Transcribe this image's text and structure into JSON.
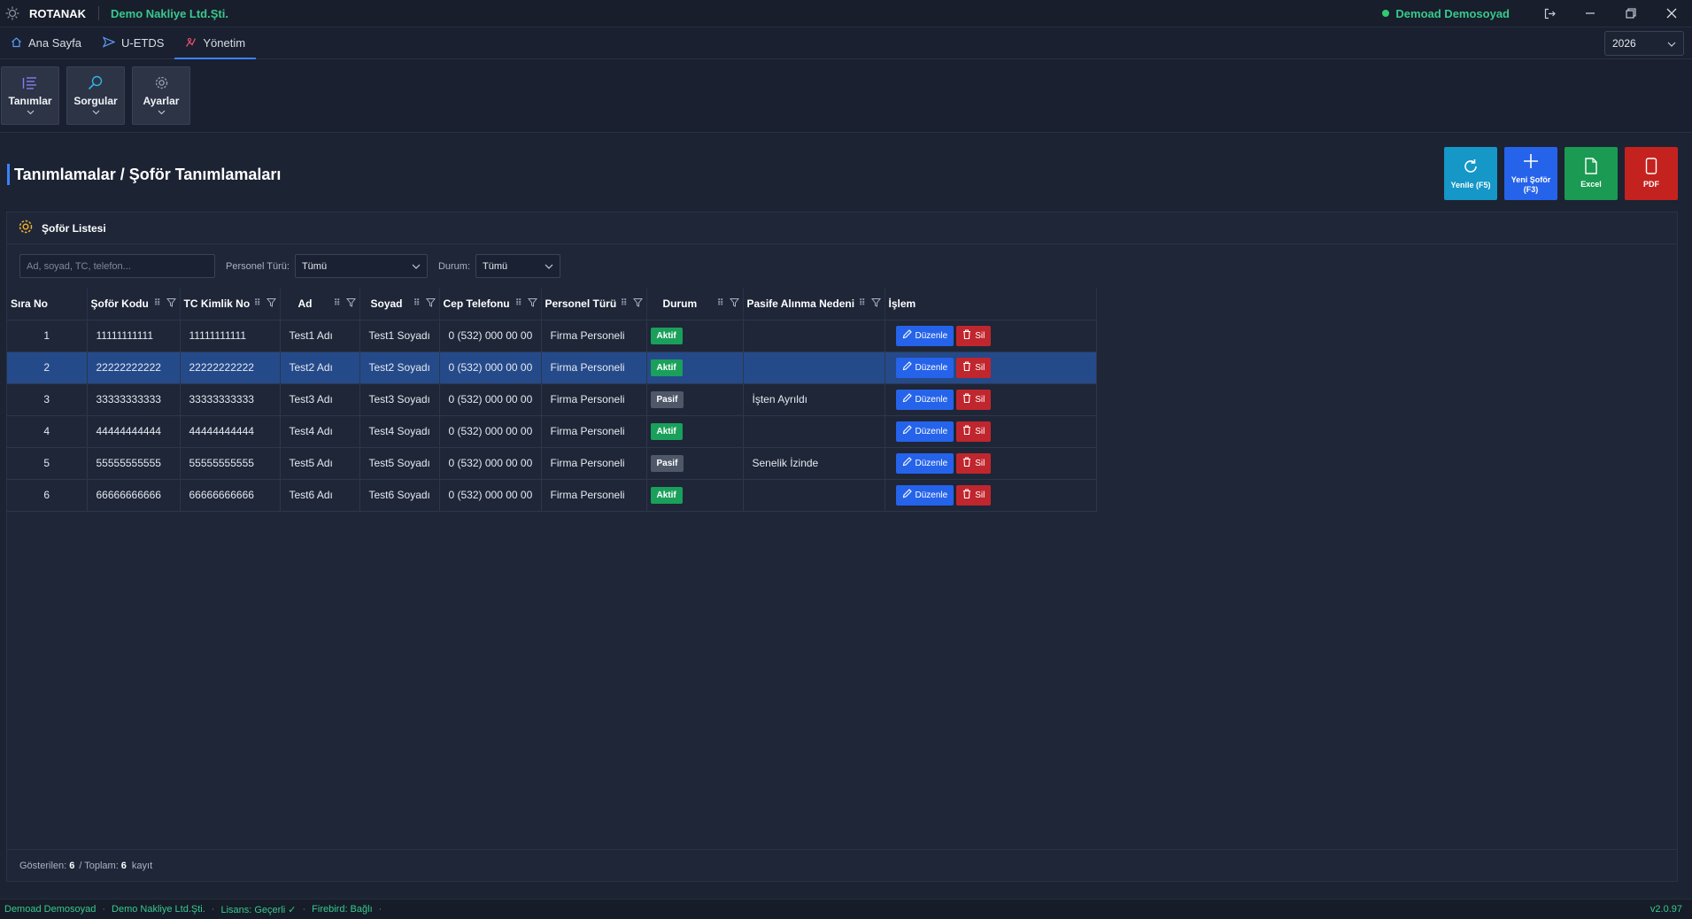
{
  "titlebar": {
    "app_name": "ROTANAK",
    "company": "Demo Nakliye Ltd.Şti.",
    "user": "Demoad Demosoyad"
  },
  "nav": {
    "tabs": [
      {
        "label": "Ana Sayfa",
        "icon": "home-icon"
      },
      {
        "label": "U-ETDS",
        "icon": "send-icon"
      },
      {
        "label": "Yönetim",
        "icon": "chart-icon",
        "active": true
      }
    ],
    "year": "2026"
  },
  "ribbon": {
    "items": [
      {
        "label": "Tanımlar",
        "icon": "list-icon"
      },
      {
        "label": "Sorgular",
        "icon": "search-icon"
      },
      {
        "label": "Ayarlar",
        "icon": "gear-icon"
      }
    ]
  },
  "page": {
    "title": "Tanımlamalar / Şoför Tanımlamaları"
  },
  "actions": {
    "refresh": "Yenile (F5)",
    "new_driver": "Yeni Şoför (F3)",
    "excel": "Excel",
    "pdf": "PDF"
  },
  "panel": {
    "title": "Şoför Listesi",
    "search_placeholder": "Ad, soyad, TC, telefon...",
    "personnel_type_label": "Personel Türü:",
    "personnel_type_value": "Tümü",
    "status_label": "Durum:",
    "status_value": "Tümü"
  },
  "table": {
    "columns": [
      "Sıra No",
      "Şoför Kodu",
      "TC Kimlik No",
      "Ad",
      "Soyad",
      "Cep Telefonu",
      "Personel Türü",
      "Durum",
      "Pasife Alınma Nedeni",
      "İşlem"
    ],
    "rows": [
      {
        "no": "1",
        "code": "11111111111",
        "tc": "11111111111",
        "name": "Test1 Adı",
        "surname": "Test1 Soyadı",
        "phone": "0 (532) 000 00 00",
        "type": "Firma Personeli",
        "status": "Aktif",
        "reason": ""
      },
      {
        "no": "2",
        "code": "22222222222",
        "tc": "22222222222",
        "name": "Test2 Adı",
        "surname": "Test2 Soyadı",
        "phone": "0 (532) 000 00 00",
        "type": "Firma Personeli",
        "status": "Aktif",
        "reason": ""
      },
      {
        "no": "3",
        "code": "33333333333",
        "tc": "33333333333",
        "name": "Test3 Adı",
        "surname": "Test3 Soyadı",
        "phone": "0 (532) 000 00 00",
        "type": "Firma Personeli",
        "status": "Pasif",
        "reason": "İşten Ayrıldı"
      },
      {
        "no": "4",
        "code": "44444444444",
        "tc": "44444444444",
        "name": "Test4 Adı",
        "surname": "Test4 Soyadı",
        "phone": "0 (532) 000 00 00",
        "type": "Firma Personeli",
        "status": "Aktif",
        "reason": ""
      },
      {
        "no": "5",
        "code": "55555555555",
        "tc": "55555555555",
        "name": "Test5 Adı",
        "surname": "Test5 Soyadı",
        "phone": "0 (532) 000 00 00",
        "type": "Firma Personeli",
        "status": "Pasif",
        "reason": "Senelik İzinde"
      },
      {
        "no": "6",
        "code": "66666666666",
        "tc": "66666666666",
        "name": "Test6 Adı",
        "surname": "Test6 Soyadı",
        "phone": "0 (532) 000 00 00",
        "type": "Firma Personeli",
        "status": "Aktif",
        "reason": ""
      }
    ],
    "edit_label": "Düzenle",
    "delete_label": "Sil",
    "selected_row": "2"
  },
  "footer": {
    "shown_label": "Gösterilen:",
    "shown": "6",
    "total_label": "/ Toplam:",
    "total": "6",
    "unit": "kayıt"
  },
  "statusbar": {
    "user": "Demoad Demosoyad",
    "company": "Demo Nakliye Ltd.Şti.",
    "license": "Lisans: Geçerli ✓",
    "firebird": "Firebird: Bağlı",
    "version": "v2.0.97"
  },
  "colors": {
    "accent": "#3b82f6",
    "success": "#1aa05a",
    "danger": "#c0262d",
    "brand_green": "#38c98d",
    "refresh_btn": "#1597c7",
    "new_btn": "#2563eb",
    "excel_btn": "#1a9a52",
    "pdf_btn": "#c4221f"
  }
}
